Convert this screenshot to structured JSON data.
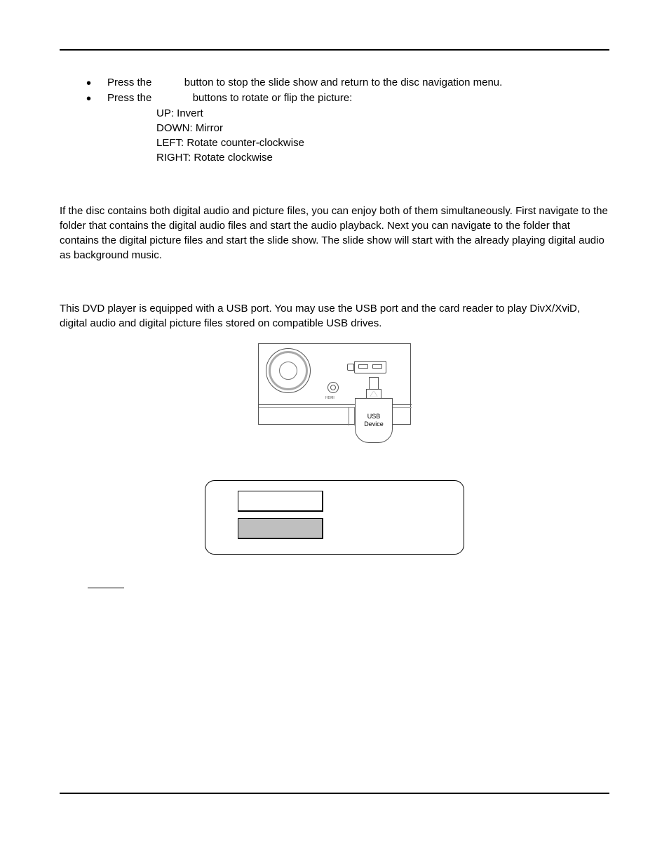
{
  "bullets": {
    "b1_pre": "Press the ",
    "b1_post": " button to stop the slide show and return to the disc navigation menu.",
    "b2_pre": "Press the ",
    "b2_post": " buttons to rotate or flip the picture:"
  },
  "rotate": {
    "up": "UP: Invert",
    "down": "DOWN: Mirror",
    "left": "LEFT: Rotate counter-clockwise",
    "right": "RIGHT: Rotate clockwise"
  },
  "para1": "If the disc contains both digital audio and picture files, you can enjoy both of them simultaneously.  First navigate to the folder that contains the digital audio files and start the audio playback.  Next you can navigate to the folder that contains the digital picture files and start the slide show.  The slide show will start with the already playing digital audio as background music.",
  "para2": "This DVD player is equipped with a USB port. You may use the USB port and the card reader to play DivX/XviD, digital audio and digital picture files stored on compatible USB drives.",
  "diagram": {
    "usb_line1": "USB",
    "usb_line2": "Device",
    "hdmi": "HDMI"
  }
}
